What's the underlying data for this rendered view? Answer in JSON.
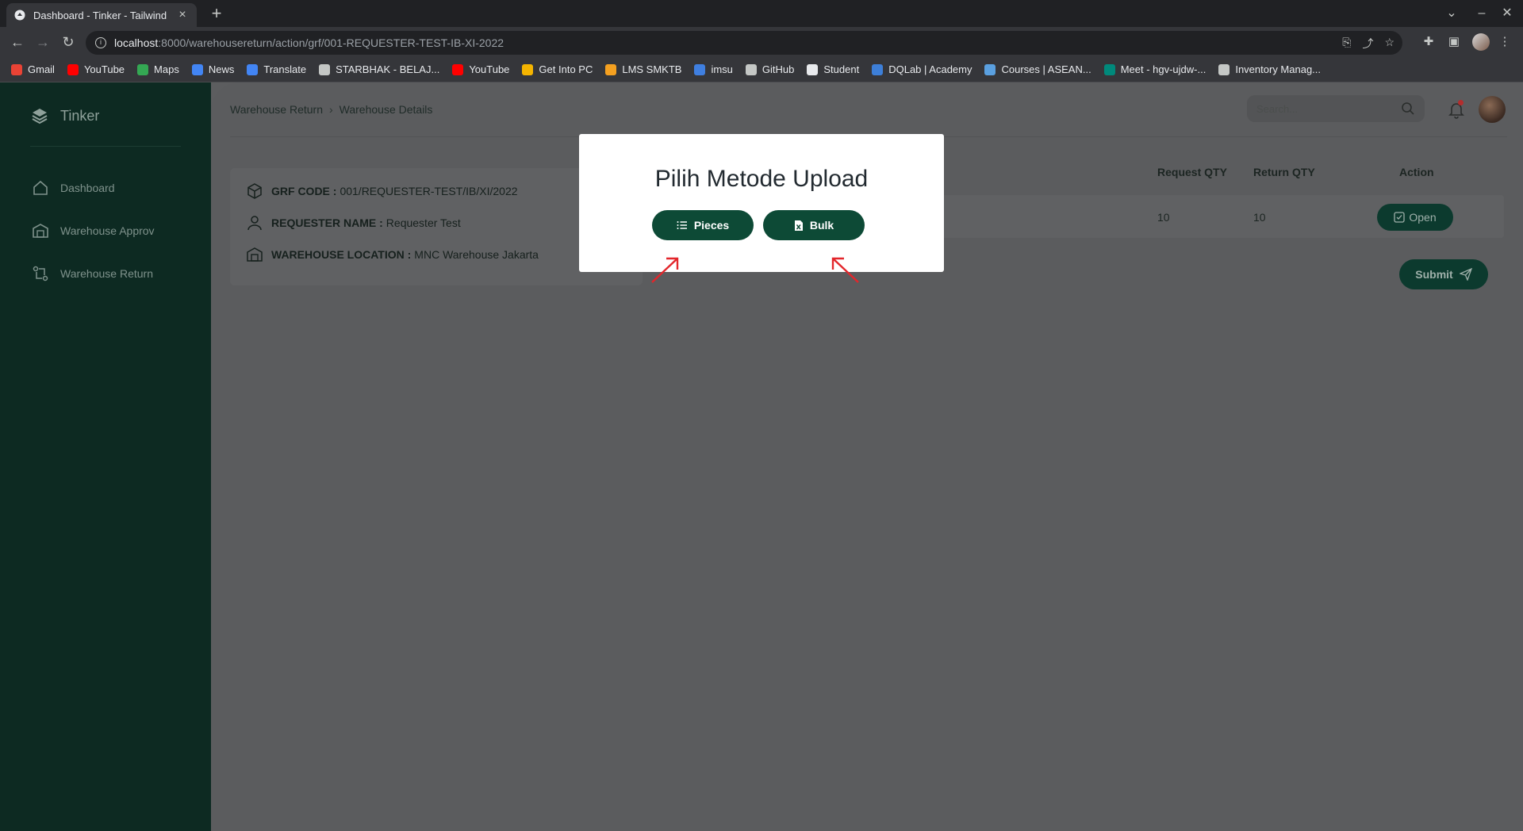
{
  "browser": {
    "tab_title": "Dashboard - Tinker - Tailwind",
    "tab_close": "×",
    "new_tab": "+",
    "url_host": "localhost",
    "url_path": ":8000/warehousereturn/action/grf/001-REQUESTER-TEST-IB-XI-2022",
    "bookmarks": [
      {
        "label": "Gmail",
        "color": "#ea4335"
      },
      {
        "label": "YouTube",
        "color": "#ff0000"
      },
      {
        "label": "Maps",
        "color": "#34a853"
      },
      {
        "label": "News",
        "color": "#4285f4"
      },
      {
        "label": "Translate",
        "color": "#4285f4"
      },
      {
        "label": "STARBHAK - BELAJ...",
        "color": "#c4c7c5"
      },
      {
        "label": "YouTube",
        "color": "#ff0000"
      },
      {
        "label": "Get Into PC",
        "color": "#f4b400"
      },
      {
        "label": "LMS SMKTB",
        "color": "#f4a020"
      },
      {
        "label": "imsu",
        "color": "#3f7fe0"
      },
      {
        "label": "GitHub",
        "color": "#c4c7c5"
      },
      {
        "label": "Student",
        "color": "#e8eaed"
      },
      {
        "label": "DQLab | Academy",
        "color": "#3d7fd8"
      },
      {
        "label": "Courses | ASEAN...",
        "color": "#5aa0e0"
      },
      {
        "label": "Meet - hgv-ujdw-...",
        "color": "#00897b"
      },
      {
        "label": "Inventory Manag...",
        "color": "#c4c7c5"
      }
    ]
  },
  "app": {
    "brand": "Tinker",
    "nav": [
      {
        "label": "Dashboard",
        "icon": "home-icon"
      },
      {
        "label": "Warehouse Approv",
        "icon": "warehouse-icon"
      },
      {
        "label": "Warehouse Return",
        "icon": "return-icon"
      }
    ],
    "breadcrumb": {
      "parent": "Warehouse Return",
      "separator": "›",
      "current": "Warehouse Details"
    },
    "search_placeholder": "Search...",
    "info": {
      "grf_label": "GRF CODE :",
      "grf_value": "001/REQUESTER-TEST/IB/XI/2022",
      "requester_label": "REQUESTER NAME :",
      "requester_value": "Requester Test",
      "location_label": "WAREHOUSE LOCATION :",
      "location_value": "MNC Warehouse Jakarta"
    },
    "table": {
      "headers": [
        "Request QTY",
        "Return QTY",
        "Action"
      ],
      "row": {
        "request_qty": "10",
        "return_qty": "10",
        "action_label": "Open"
      }
    },
    "submit_label": "Submit"
  },
  "modal": {
    "title": "Pilih Metode Upload",
    "pieces_label": "Pieces",
    "bulk_label": "Bulk"
  },
  "colors": {
    "sidebar": "#0d2a22",
    "primary_button": "#0d4a36",
    "overlay": "#5c5d5f",
    "annotation_arrow": "#e3262b"
  }
}
